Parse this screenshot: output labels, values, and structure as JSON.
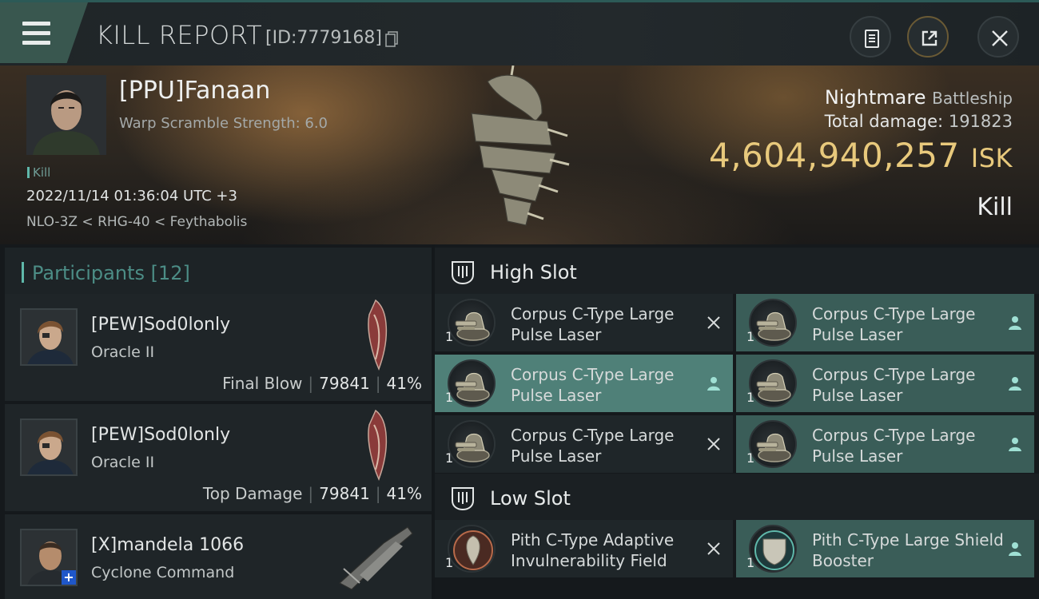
{
  "header": {
    "title": "KILL REPORT",
    "report_id": "[ID:7779168]"
  },
  "victim": {
    "name": "[PPU]Fanaan",
    "warp_scramble": "Warp Scramble Strength: 6.0",
    "kill_tag": "Kill",
    "timestamp": "2022/11/14 01:36:04 UTC +3",
    "location": "NLO-3Z < RHG-40 < Feythabolis",
    "ship_name": "Nightmare",
    "ship_class": "Battleship",
    "total_damage_label": "Total damage:",
    "total_damage_value": "191823",
    "isk_value": "4,604,940,257",
    "isk_unit": "ISK",
    "result": "Kill"
  },
  "participants": {
    "label": "Participants",
    "count": "[12]",
    "items": [
      {
        "name": "[PEW]Sod0lonly",
        "ship": "Oracle II",
        "role": "Final Blow",
        "damage": "79841",
        "percent": "41%"
      },
      {
        "name": "[PEW]Sod0lonly",
        "ship": "Oracle II",
        "role": "Top Damage",
        "damage": "79841",
        "percent": "41%"
      },
      {
        "name": "[X]mandela 1066",
        "ship": "Cyclone Command",
        "role": "",
        "damage": "",
        "percent": ""
      }
    ]
  },
  "slots": {
    "high": {
      "label": "High Slot",
      "modules": [
        {
          "name": "Corpus C-Type Large Pulse Laser",
          "qty": "1",
          "status": "destroyed"
        },
        {
          "name": "Corpus C-Type Large Pulse Laser",
          "qty": "1",
          "status": "dropped"
        },
        {
          "name": "Corpus C-Type Large Pulse Laser",
          "qty": "1",
          "status": "dropped"
        },
        {
          "name": "Corpus C-Type Large Pulse Laser",
          "qty": "1",
          "status": "dropped"
        },
        {
          "name": "Corpus C-Type Large Pulse Laser",
          "qty": "1",
          "status": "destroyed"
        },
        {
          "name": "Corpus C-Type Large Pulse Laser",
          "qty": "1",
          "status": "dropped"
        }
      ]
    },
    "low": {
      "label": "Low Slot",
      "modules": [
        {
          "name": "Pith C-Type Adaptive Invulnerability Field",
          "qty": "1",
          "status": "destroyed"
        },
        {
          "name": "Pith C-Type Large Shield Booster",
          "qty": "1",
          "status": "dropped"
        }
      ]
    }
  },
  "colors": {
    "accent": "#5fb8aa",
    "isk": "#e8c97c",
    "dropped_bg": "#3a5d58",
    "highlight_bg": "#4f8078"
  }
}
